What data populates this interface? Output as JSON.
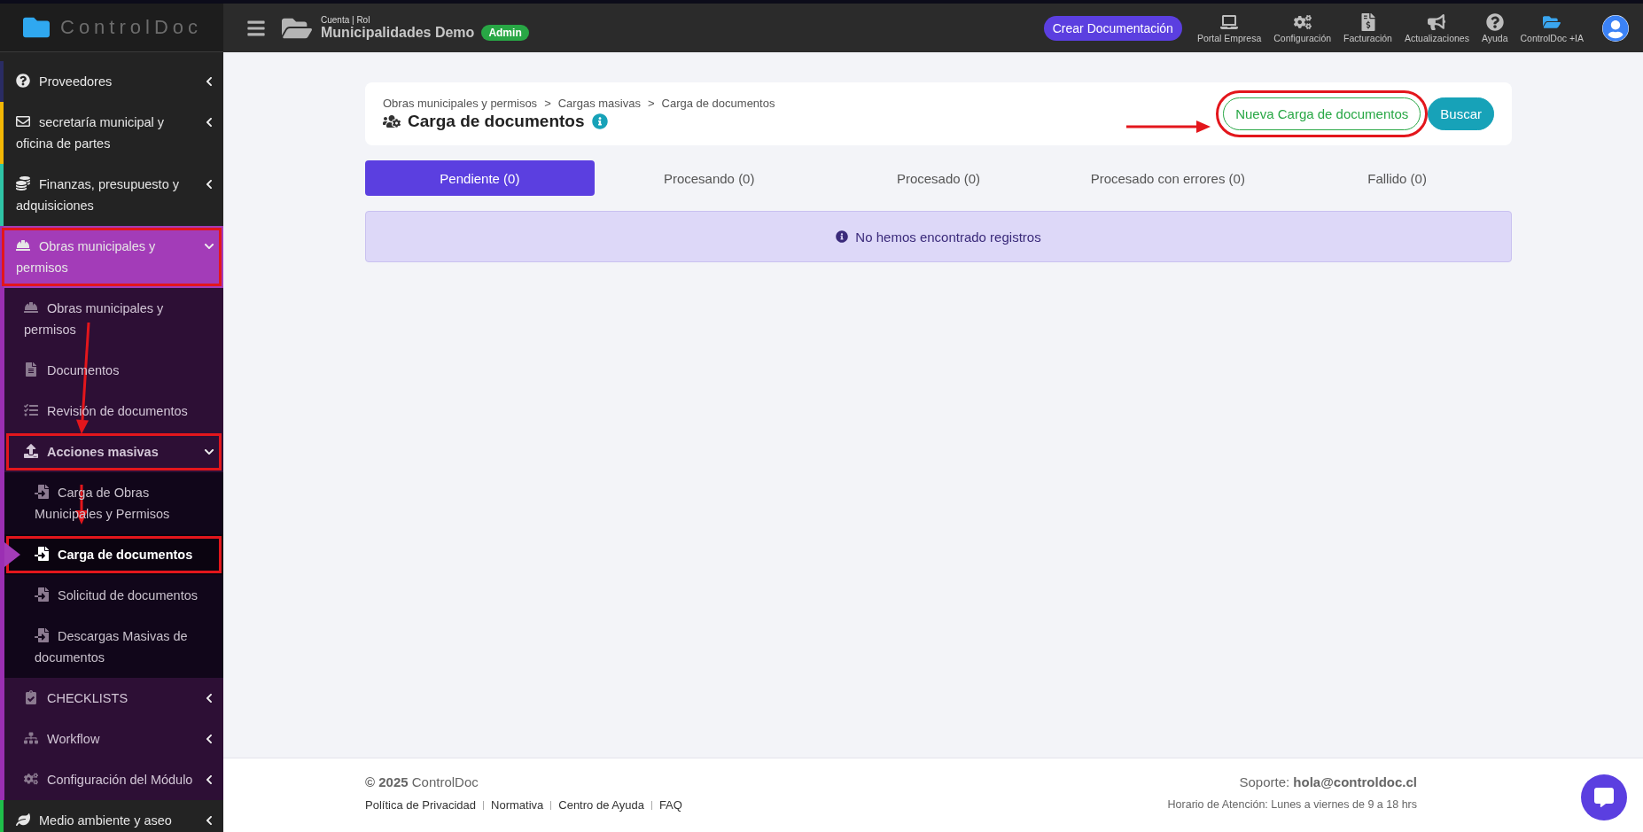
{
  "brand": "ControlDoc",
  "sidebar": {
    "items": [
      {
        "label": "Proveedores",
        "color": "#2a2c63",
        "expanded": false,
        "selected": false,
        "highlighted": false
      },
      {
        "label": "secretaría municipal y oficina de partes",
        "color": "#f2b705",
        "expanded": false,
        "selected": false,
        "highlighted": false
      },
      {
        "label": "Finanzas, presupuesto y adquisiciones",
        "color": "#2fc4a6",
        "expanded": false,
        "selected": false,
        "highlighted": false
      },
      {
        "label": "Obras municipales y permisos",
        "color": "#9b2fb3",
        "expanded": true,
        "selected": false,
        "highlighted": true,
        "children": [
          {
            "label": "Obras municipales y permisos",
            "expanded": false,
            "selected": false,
            "highlighted": false
          },
          {
            "label": "Documentos",
            "expanded": false,
            "selected": false,
            "highlighted": false
          },
          {
            "label": "Revisión de documentos",
            "expanded": false,
            "selected": false,
            "highlighted": false
          },
          {
            "label": "Acciones masivas",
            "expanded": true,
            "selected": false,
            "highlighted": true,
            "children": [
              {
                "label": "Carga de Obras Municipales y Permisos",
                "expanded": false,
                "selected": false,
                "highlighted": false
              },
              {
                "label": "Carga de documentos",
                "expanded": false,
                "selected": true,
                "highlighted": true
              },
              {
                "label": "Solicitud de documentos",
                "expanded": false,
                "selected": false,
                "highlighted": false
              },
              {
                "label": "Descargas Masivas de documentos",
                "expanded": false,
                "selected": false,
                "highlighted": false
              }
            ]
          },
          {
            "label": "CHECKLISTS",
            "expanded": false,
            "selected": false,
            "highlighted": false
          },
          {
            "label": "Workflow",
            "expanded": false,
            "selected": false,
            "highlighted": false
          },
          {
            "label": "Configuración del Módulo",
            "expanded": false,
            "selected": false,
            "highlighted": false
          }
        ]
      },
      {
        "label": "Medio ambiente y aseo",
        "color": "#1fbf4a",
        "expanded": false,
        "selected": false,
        "highlighted": false
      }
    ]
  },
  "header": {
    "account_caption": "Cuenta | Rol",
    "account": "Municipalidades Demo",
    "role_badge": "Admin",
    "create_button": "Crear Documentación",
    "nav": [
      "Portal Empresa",
      "Configuración",
      "Facturación",
      "Actualizaciones",
      "Ayuda",
      "ControlDoc +IA"
    ]
  },
  "page": {
    "breadcrumb_separator": ">",
    "breadcrumb": [
      "Obras municipales y permisos",
      "Cargas masivas",
      "Carga de documentos"
    ],
    "title": "Carga de documentos",
    "actions": [
      {
        "label": "Nueva Carga de documentos",
        "kind": "outline",
        "highlighted": true
      },
      {
        "label": "Buscar",
        "kind": "solid",
        "highlighted": false
      }
    ],
    "tabs": [
      {
        "label": "Pendiente (0)",
        "selected": true
      },
      {
        "label": "Procesando (0)",
        "selected": false
      },
      {
        "label": "Procesado (0)",
        "selected": false
      },
      {
        "label": "Procesado con errores (0)",
        "selected": false
      },
      {
        "label": "Fallido (0)",
        "selected": false
      }
    ],
    "alert": "No hemos encontrado registros"
  },
  "footer": {
    "copyright": "**© 2025** ControlDoc",
    "links": [
      "Política de Privacidad",
      "Normativa",
      "Centro de Ayuda",
      "FAQ"
    ],
    "support": "Soporte: **hola@controldoc.cl**",
    "hours": "Horario de Atención: Lunes a viernes de 9 a 18 hrs"
  }
}
